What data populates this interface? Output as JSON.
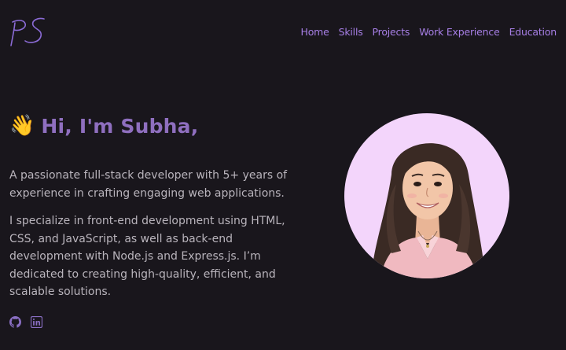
{
  "header": {
    "logo_text": "PS",
    "nav": [
      "Home",
      "Skills",
      "Projects",
      "Work Experience",
      "Education"
    ]
  },
  "hero": {
    "wave_emoji": "👋",
    "greeting": "Hi, I'm Subha,",
    "intro": "A passionate full-stack developer with 5+ years of experience in crafting engaging web applications.",
    "description": "I specialize in front-end development using HTML, CSS, and JavaScript, as well as back-end development with Node.js and Express.js. I’m dedicated to creating high-quality, efficient, and scalable solutions."
  },
  "socials": {
    "icons": [
      "github-icon",
      "linkedin-icon"
    ]
  },
  "colors": {
    "background": "#19161c",
    "accent": "#a77fe6",
    "heading": "#8f6fbf",
    "text": "#b9b4bc",
    "avatar_bg": "#f3d5fb"
  }
}
